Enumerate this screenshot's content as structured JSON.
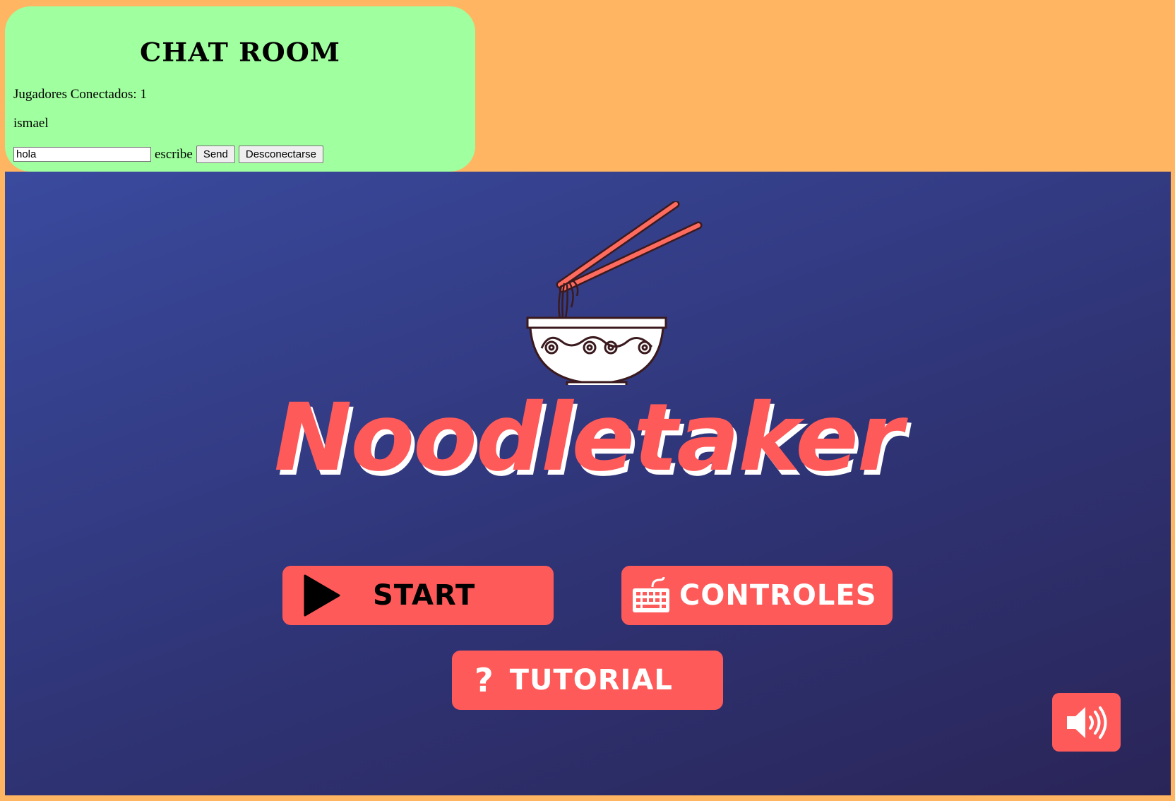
{
  "chat": {
    "title": "CHAT ROOM",
    "players_label": "Jugadores Conectados: 1",
    "users": [
      "ismael"
    ],
    "message_input_value": "hola",
    "input_hint": "escribe",
    "send_label": "Send",
    "disconnect_label": "Desconectarse"
  },
  "game": {
    "title": "Noodletaker",
    "menu": {
      "start_label": "START",
      "controls_label": "CONTROLES",
      "tutorial_label": "TUTORIAL",
      "tutorial_icon_glyph": "?"
    },
    "icons": {
      "logo": "noodle-bowl-chopsticks",
      "start": "play-icon",
      "controls": "keyboard-icon",
      "tutorial": "question-icon",
      "sound": "speaker-volume-icon"
    },
    "colors": {
      "page_background": "#ffb562",
      "chat_panel": "#a0ff9f",
      "accent": "#ff5a5a",
      "canvas_top": "#3a4a9e",
      "canvas_bottom": "#2a2558"
    }
  }
}
